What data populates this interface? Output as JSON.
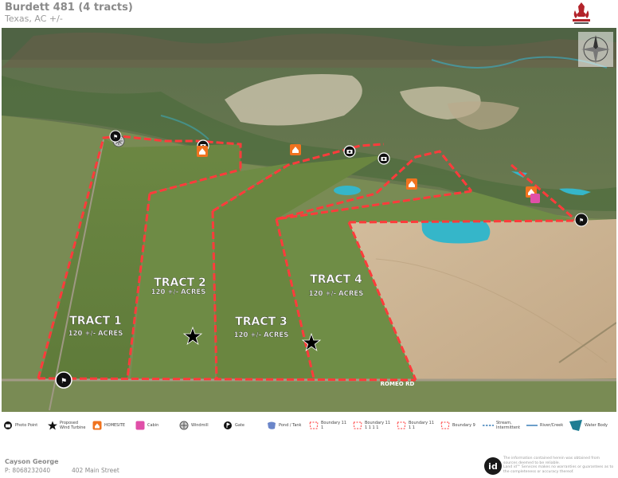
{
  "header": {
    "title": "Burdett 481 (4 tracts)",
    "subtitle": "Texas,  AC +/-"
  },
  "map": {
    "tracts": [
      {
        "name": "TRACT 1",
        "acres": "120 +/- ACRES"
      },
      {
        "name": "TRACT 2",
        "acres": "120 +/- ACRES"
      },
      {
        "name": "TRACT 3",
        "acres": "120 +/- ACRES"
      },
      {
        "name": "TRACT 4",
        "acres": "120 +/- ACRES"
      }
    ],
    "road_label": "ROMEO RD",
    "colors": {
      "boundary": "#ff3b3b",
      "field": "#6f8a45",
      "plowed": "#c9b08f",
      "water": "#35b6c9",
      "homesite": "#f0731f",
      "cabin": "#e04fa8"
    }
  },
  "legend": [
    {
      "icon": "camera-icon",
      "label": "Photo Point"
    },
    {
      "icon": "star-icon",
      "label": "Proposed\nWind Turbine"
    },
    {
      "icon": "home-icon",
      "label": "HOMESITE"
    },
    {
      "icon": "cabin-icon",
      "label": "Cabin"
    },
    {
      "icon": "windmill-icon",
      "label": "Windmill"
    },
    {
      "icon": "gate-icon",
      "label": "Gate"
    },
    {
      "icon": "pond-icon",
      "label": "Pond / Tank"
    },
    {
      "icon": "boundary-icon",
      "label": "Boundary 11\n1"
    },
    {
      "icon": "boundary-icon",
      "label": "Boundary 11\n1 1 1 1"
    },
    {
      "icon": "boundary-icon",
      "label": "Boundary 11\n1 1"
    },
    {
      "icon": "boundary-icon",
      "label": "Boundary 9"
    },
    {
      "icon": "stream-icon",
      "label": "Stream,\nIntermittent"
    },
    {
      "icon": "river-icon",
      "label": "River/Creek"
    },
    {
      "icon": "water-body-icon",
      "label": "Water Body"
    }
  ],
  "footer": {
    "agent_name": "Cayson George",
    "phone": "P: 8068232040",
    "address": "402 Main Street",
    "id_logo": "id",
    "disclaimer": "The information contained herein was obtained from sources deemed to be reliable.\nLand id™ Services makes no warranties or guarantees as to the completeness or accuracy thereof."
  }
}
